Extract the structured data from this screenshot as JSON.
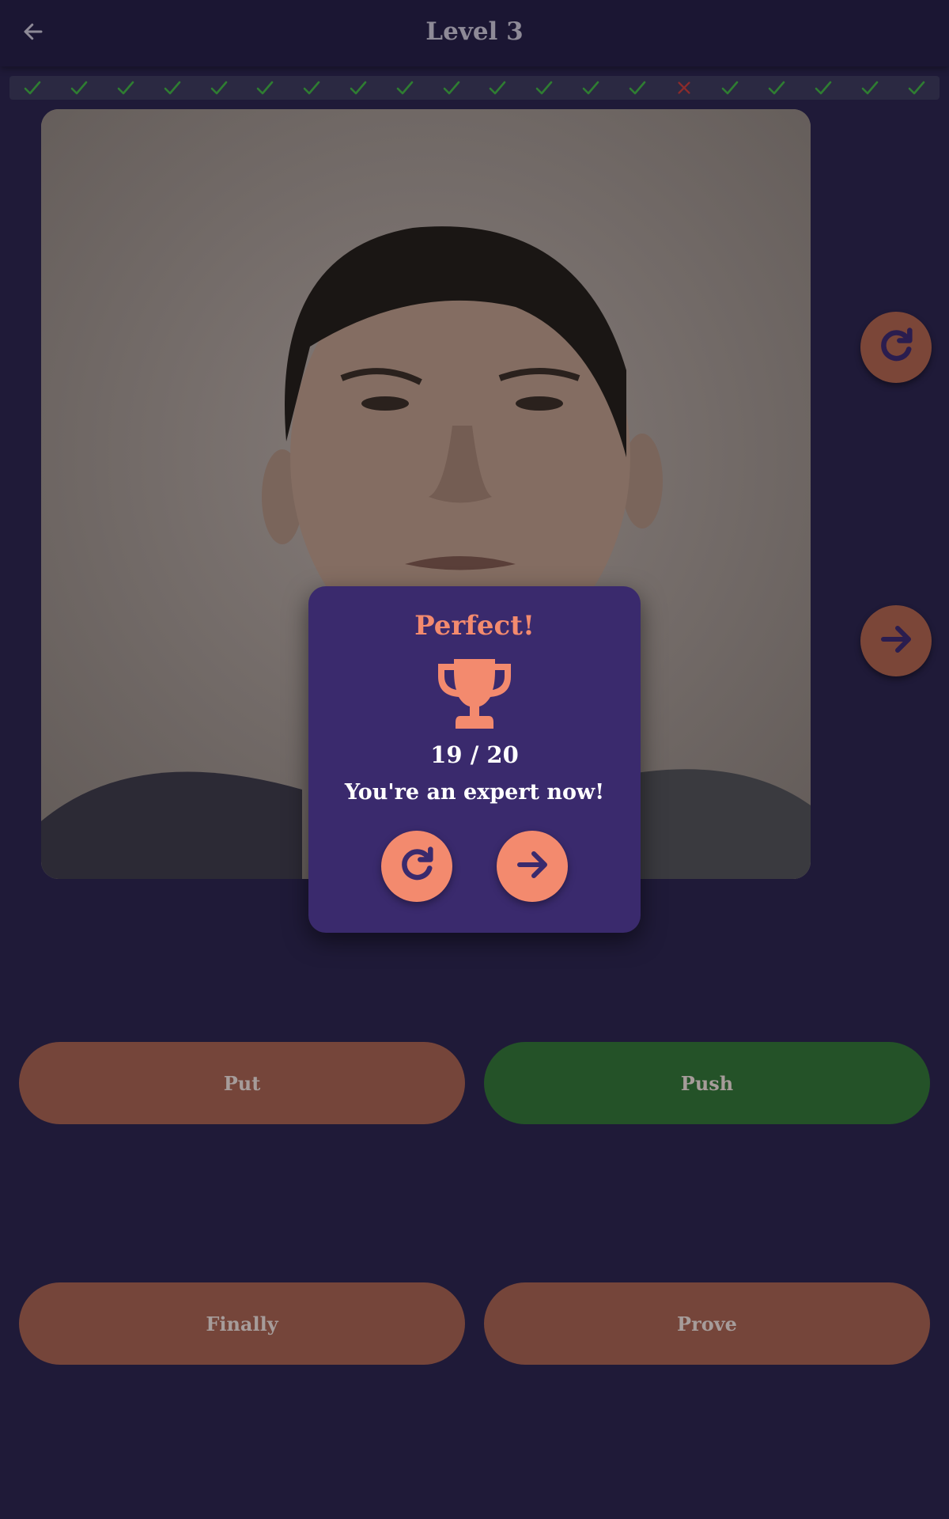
{
  "header": {
    "title": "Level 3",
    "back_icon": "arrow-left-icon"
  },
  "progress": {
    "results": [
      "correct",
      "correct",
      "correct",
      "correct",
      "correct",
      "correct",
      "correct",
      "correct",
      "correct",
      "correct",
      "correct",
      "correct",
      "correct",
      "correct",
      "wrong",
      "correct",
      "correct",
      "correct",
      "correct",
      "correct"
    ]
  },
  "side_controls": {
    "replay_icon": "replay-icon",
    "next_icon": "arrow-right-icon"
  },
  "answers": [
    {
      "label": "Put",
      "state": "neutral"
    },
    {
      "label": "Push",
      "state": "correct"
    },
    {
      "label": "Finally",
      "state": "neutral"
    },
    {
      "label": "Prove",
      "state": "neutral"
    }
  ],
  "result_dialog": {
    "title": "Perfect!",
    "icon": "trophy-icon",
    "score": "19 / 20",
    "message": "You're an expert now!",
    "retry_icon": "replay-icon",
    "next_icon": "arrow-right-icon"
  },
  "colors": {
    "background": "#1f1a38",
    "accent": "#f38a6e",
    "dialog": "#3a2a6d",
    "correct": "#245228",
    "neutral": "#75453a",
    "check": "#2f7d32",
    "wrong": "#8b2b2b"
  }
}
